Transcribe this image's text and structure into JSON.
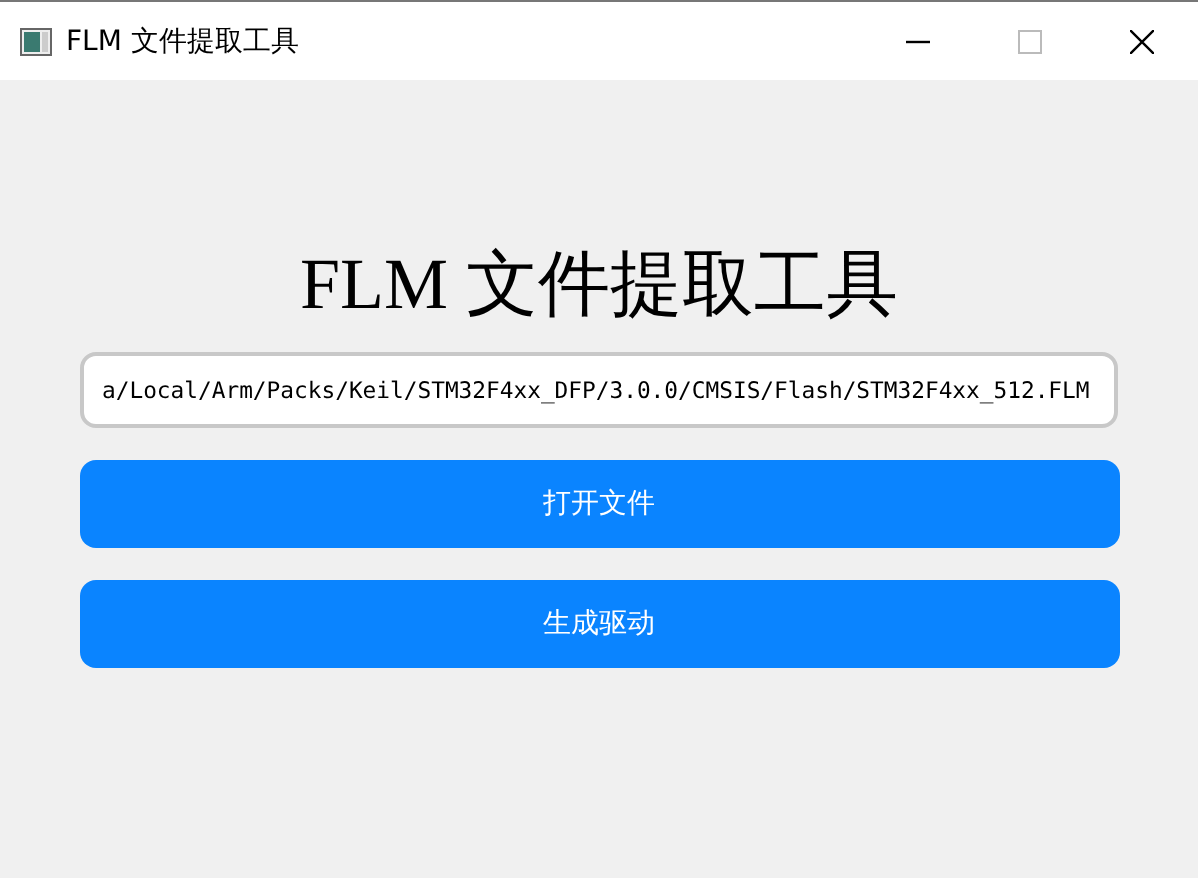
{
  "window": {
    "title": "FLM 文件提取工具"
  },
  "heading": "FLM 文件提取工具",
  "path_field": {
    "value": "a/Local/Arm/Packs/Keil/STM32F4xx_DFP/3.0.0/CMSIS/Flash/STM32F4xx_512.FLM"
  },
  "buttons": [
    "打开文件",
    "生成驱动"
  ]
}
